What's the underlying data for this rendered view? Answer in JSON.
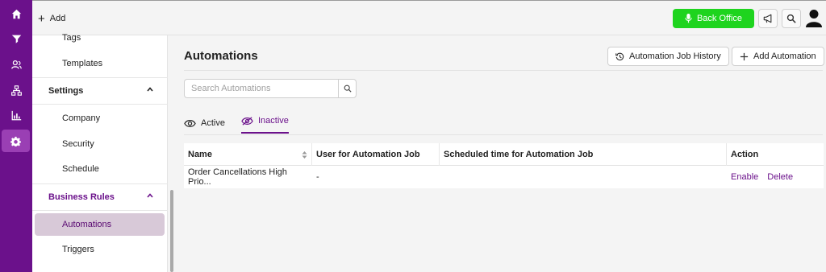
{
  "rail": {
    "items": [
      {
        "icon": "home-icon"
      },
      {
        "icon": "funnel-icon"
      },
      {
        "icon": "users-icon"
      },
      {
        "icon": "hierarchy-icon"
      },
      {
        "icon": "chart-icon"
      },
      {
        "icon": "gear-icon",
        "active": true
      }
    ]
  },
  "topbar": {
    "add_label": "Add",
    "back_office_label": "Back Office"
  },
  "sidebar": {
    "items_top": [
      {
        "label": "Tags"
      },
      {
        "label": "Templates"
      }
    ],
    "settings": {
      "label": "Settings",
      "items": [
        {
          "label": "Company"
        },
        {
          "label": "Security"
        },
        {
          "label": "Schedule"
        }
      ]
    },
    "business_rules": {
      "label": "Business Rules",
      "items": [
        {
          "label": "Automations",
          "active": true
        },
        {
          "label": "Triggers"
        }
      ]
    }
  },
  "main": {
    "title": "Automations",
    "history_button": "Automation Job History",
    "add_button": "Add Automation",
    "search": {
      "placeholder": "Search Automations",
      "value": ""
    },
    "tabs": [
      {
        "label": "Active",
        "selected": false
      },
      {
        "label": "Inactive",
        "selected": true
      }
    ],
    "table": {
      "columns": [
        "Name",
        "User for Automation Job",
        "Scheduled time for Automation Job",
        "Action"
      ],
      "rows": [
        {
          "name": "Order Cancellations High Prio...",
          "user": "-",
          "scheduled": "",
          "actions": [
            "Enable",
            "Delete"
          ]
        }
      ]
    }
  },
  "colors": {
    "brand_purple": "#6b118b",
    "back_office_green": "#1ed41e"
  }
}
